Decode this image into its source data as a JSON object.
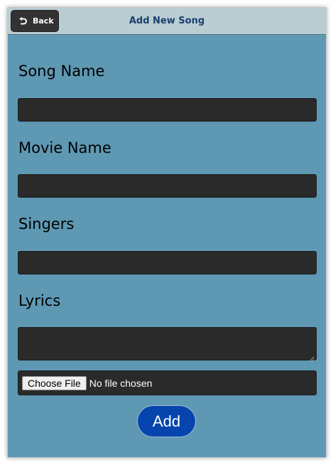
{
  "header": {
    "back_label": "Back",
    "title": "Add New Song"
  },
  "form": {
    "song_name_label": "Song Name",
    "song_name_value": "",
    "movie_name_label": "Movie Name",
    "movie_name_value": "",
    "singers_label": "Singers",
    "singers_value": "",
    "lyrics_label": "Lyrics",
    "lyrics_value": "",
    "file_button_label": "Choose File",
    "file_status": "No file chosen",
    "submit_label": "Add"
  },
  "icons": {
    "back": "back-arrow-icon",
    "resize": "resize-grip-icon"
  },
  "colors": {
    "page_background": "#5e98b3",
    "header_background": "#b9cdd2",
    "title_color": "#1b3f6e",
    "field_background": "#2a2a2a",
    "add_button": "#0645ad"
  }
}
